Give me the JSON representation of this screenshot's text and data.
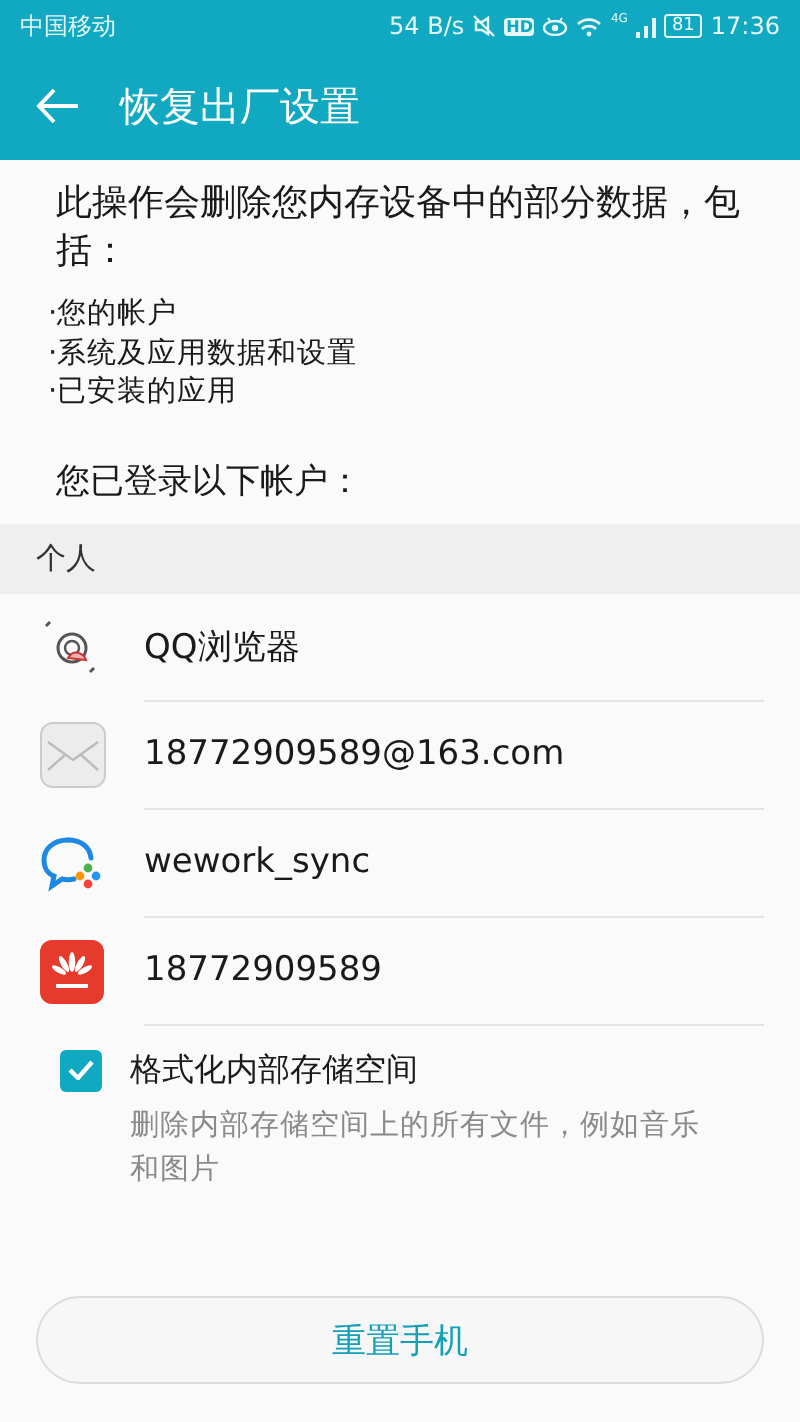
{
  "status_bar": {
    "carrier": "中国移动",
    "speed": "54 B/s",
    "hd": "HD",
    "network": "4G",
    "battery": "81",
    "time": "17:36"
  },
  "toolbar": {
    "title": "恢复出厂设置"
  },
  "intro": "此操作会删除您内存设备中的部分数据，包括：",
  "bullets": [
    "·您的帐户",
    "·系统及应用数据和设置",
    "·已安装的应用"
  ],
  "accounts_heading": "您已登录以下帐户：",
  "section": "个人",
  "accounts": [
    {
      "kind": "browser",
      "name": "QQ浏览器"
    },
    {
      "kind": "mail",
      "name": "18772909589@163.com"
    },
    {
      "kind": "wework",
      "name": "wework_sync"
    },
    {
      "kind": "huawei",
      "name": "18772909589"
    }
  ],
  "format_option": {
    "label": "格式化内部存储空间",
    "description": "删除内部存储空间上的所有文件，例如音乐和图片",
    "checked": true
  },
  "reset_button": "重置手机"
}
